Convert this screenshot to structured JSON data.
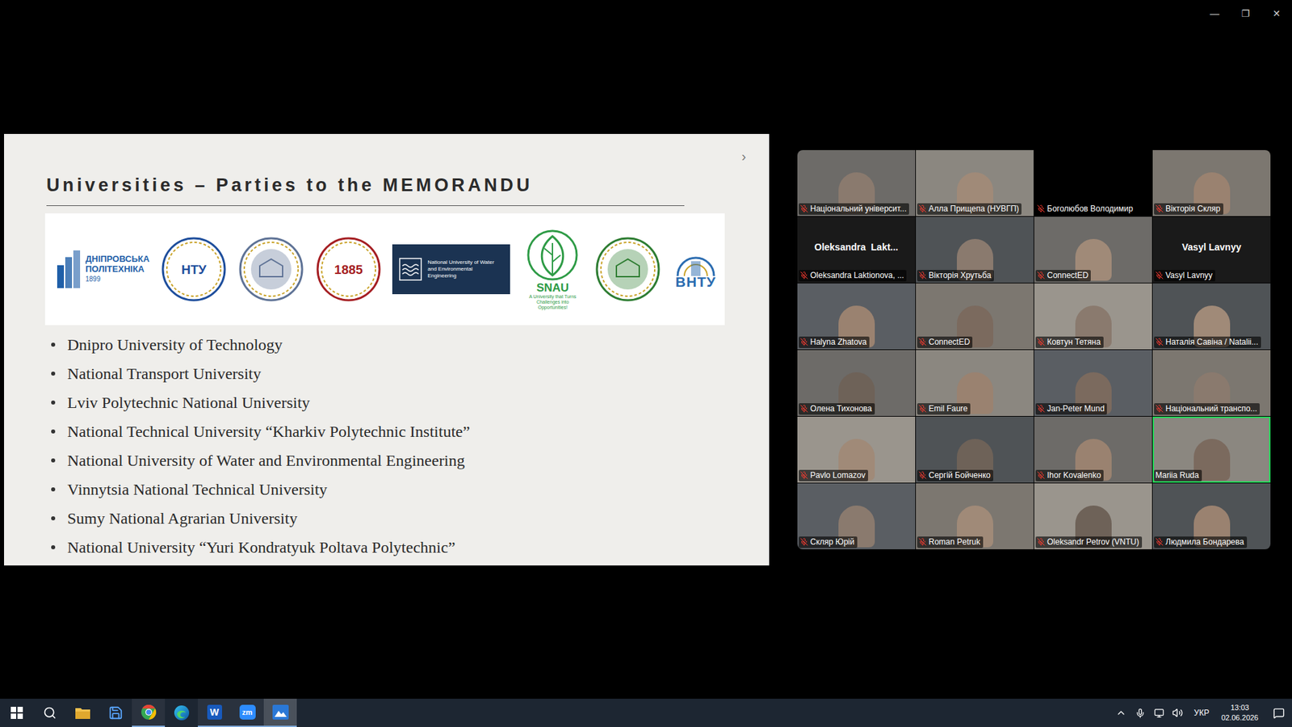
{
  "window": {
    "controls": [
      {
        "kind": "minimize",
        "glyph": "—"
      },
      {
        "kind": "restore",
        "glyph": "❐"
      },
      {
        "kind": "close",
        "glyph": "✕"
      }
    ]
  },
  "slide": {
    "title": "Universities – Parties to the MEMORANDU",
    "next_arrow": "›",
    "logos": [
      {
        "kind": "dnipro",
        "lines": [
          "ДНІПРОВСЬКА",
          "ПОЛІТЕХНІКА",
          "1899"
        ],
        "color": "#1f5fa8"
      },
      {
        "kind": "seal",
        "text": "НТУ",
        "color": "#1e4e9c"
      },
      {
        "kind": "seal",
        "color": "#5f7396"
      },
      {
        "kind": "seal",
        "text": "1885",
        "color": "#a51e22"
      },
      {
        "kind": "banner",
        "text": "National University of Water and Environmental Engineering",
        "color": "#1b3352"
      },
      {
        "kind": "snau",
        "text": "SNAU",
        "tagline": "A University that Turns Challenges into Opportunities!",
        "color": "#2e9b46"
      },
      {
        "kind": "seal",
        "color": "#2e7d32"
      },
      {
        "kind": "vntu",
        "text": "ВНТУ",
        "color": "#2b6cb0"
      }
    ],
    "bullets": [
      "Dnipro University of Technology",
      "National Transport University",
      "Lviv Polytechnic National University",
      "National Technical University “Kharkiv Polytechnic Institute”",
      "National University of Water and Environmental Engineering",
      "Vinnytsia National Technical University",
      "Sumy National Agrarian University",
      "National University “Yuri Kondratyuk Poltava Polytechnic”"
    ]
  },
  "gallery": {
    "tiles": [
      {
        "name": "Національний університ...",
        "kind": "video",
        "muted": true,
        "selected": false
      },
      {
        "name": "Алла Прищепа (НУВГП)",
        "kind": "video",
        "muted": true,
        "selected": false
      },
      {
        "name": "Боголюбов Володимир",
        "kind": "blank",
        "muted": true,
        "selected": false
      },
      {
        "name": "Вікторія Скляр",
        "kind": "video",
        "muted": true,
        "selected": false
      },
      {
        "name": "Oleksandra Laktionova, ...",
        "kind": "name",
        "display": "Oleksandra  Lakt...",
        "muted": true,
        "selected": false
      },
      {
        "name": "Вікторія Хрутьба",
        "kind": "video",
        "muted": true,
        "selected": false
      },
      {
        "name": "ConnectED",
        "kind": "video",
        "muted": true,
        "selected": false
      },
      {
        "name": "Vasyl Lavnyy",
        "kind": "name",
        "display": "Vasyl Lavnyy",
        "muted": true,
        "selected": false
      },
      {
        "name": "Halyna Zhatova",
        "kind": "video",
        "muted": true,
        "selected": false
      },
      {
        "name": "ConnectED",
        "kind": "video",
        "muted": true,
        "selected": false
      },
      {
        "name": "Ковтун Тетяна",
        "kind": "video",
        "muted": true,
        "selected": false
      },
      {
        "name": "Наталія Савіна / Natalii...",
        "kind": "video",
        "muted": true,
        "selected": false
      },
      {
        "name": "Олена Тихонова",
        "kind": "video",
        "muted": true,
        "selected": false
      },
      {
        "name": "Emil Faure",
        "kind": "video",
        "muted": true,
        "selected": false
      },
      {
        "name": "Jan-Peter Mund",
        "kind": "video",
        "muted": true,
        "selected": false
      },
      {
        "name": "Національний транспо...",
        "kind": "video",
        "muted": true,
        "selected": false
      },
      {
        "name": "Pavlo Lomazov",
        "kind": "video",
        "muted": true,
        "selected": false
      },
      {
        "name": "Сергій Бойченко",
        "kind": "video",
        "muted": true,
        "selected": false
      },
      {
        "name": "Ihor Kovalenko",
        "kind": "video",
        "muted": true,
        "selected": false
      },
      {
        "name": "Mariia Ruda",
        "kind": "video",
        "muted": false,
        "selected": true
      },
      {
        "name": "Скляр Юрій",
        "kind": "video",
        "muted": true,
        "selected": false
      },
      {
        "name": "Roman Petruk",
        "kind": "video",
        "muted": true,
        "selected": false
      },
      {
        "name": "Oleksandr Petrov (VNTU)",
        "kind": "video",
        "muted": true,
        "selected": false
      },
      {
        "name": "Людмила Бондарева",
        "kind": "video",
        "muted": true,
        "selected": false
      }
    ]
  },
  "taskbar": {
    "apps": [
      {
        "kind": "start",
        "active": false,
        "selected": false
      },
      {
        "kind": "search",
        "active": false,
        "selected": false
      },
      {
        "kind": "explorer",
        "active": false,
        "selected": false
      },
      {
        "kind": "save",
        "active": false,
        "selected": false
      },
      {
        "kind": "chrome",
        "active": true,
        "selected": false
      },
      {
        "kind": "edge",
        "active": false,
        "selected": false
      },
      {
        "kind": "word",
        "label": "W",
        "active": true,
        "selected": false
      },
      {
        "kind": "zoom",
        "label": "zm",
        "active": true,
        "selected": false
      },
      {
        "kind": "photos",
        "active": true,
        "selected": true
      }
    ],
    "tray": {
      "language": "УКР",
      "time": "13:03",
      "date": "02.06.2026"
    }
  }
}
